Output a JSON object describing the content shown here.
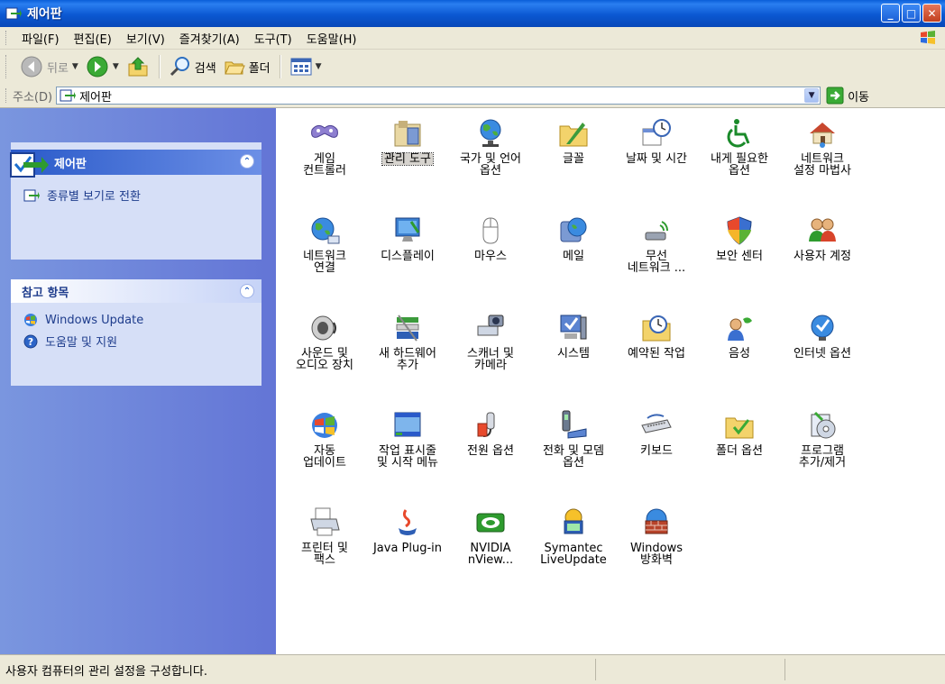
{
  "window": {
    "title": "제어판"
  },
  "menu": [
    {
      "label": "파일(F)"
    },
    {
      "label": "편집(E)"
    },
    {
      "label": "보기(V)"
    },
    {
      "label": "즐겨찾기(A)"
    },
    {
      "label": "도구(T)"
    },
    {
      "label": "도움말(H)"
    }
  ],
  "toolbar": {
    "back": "뒤로",
    "search": "검색",
    "folders": "폴더"
  },
  "address": {
    "label": "주소(D)",
    "value": "제어판",
    "go": "이동"
  },
  "sidebar": {
    "control_panel": {
      "title": "제어판",
      "switch_link": "종류별 보기로 전환"
    },
    "see_also": {
      "title": "참고 항목",
      "links": [
        "Windows Update",
        "도움말 및 지원"
      ]
    }
  },
  "icons": [
    {
      "label": "게임\n컨트롤러",
      "icon": "gamepad-icon"
    },
    {
      "label": "관리 도구",
      "icon": "admin-tools-icon"
    },
    {
      "label": "국가 및 언어\n옵션",
      "icon": "globe-icon"
    },
    {
      "label": "글꼴",
      "icon": "fonts-folder-icon"
    },
    {
      "label": "날짜 및 시간",
      "icon": "calendar-clock-icon"
    },
    {
      "label": "내게 필요한\n옵션",
      "icon": "accessibility-icon"
    },
    {
      "label": "네트워크\n설정 마법사",
      "icon": "network-house-icon"
    },
    {
      "label": "네트워크\n연결",
      "icon": "network-globe-icon"
    },
    {
      "label": "디스플레이",
      "icon": "display-icon"
    },
    {
      "label": "마우스",
      "icon": "mouse-icon"
    },
    {
      "label": "메일",
      "icon": "mail-icon"
    },
    {
      "label": "무선\n네트워크 ...",
      "icon": "wireless-icon"
    },
    {
      "label": "보안 센터",
      "icon": "shield-icon"
    },
    {
      "label": "사용자 계정",
      "icon": "users-icon"
    },
    {
      "label": "사운드 및\n오디오 장치",
      "icon": "speaker-icon"
    },
    {
      "label": "새 하드웨어\n추가",
      "icon": "hardware-icon"
    },
    {
      "label": "스캐너 및\n카메라",
      "icon": "scanner-camera-icon"
    },
    {
      "label": "시스템",
      "icon": "system-icon"
    },
    {
      "label": "예약된 작업",
      "icon": "scheduled-tasks-icon"
    },
    {
      "label": "음성",
      "icon": "speech-icon"
    },
    {
      "label": "인터넷 옵션",
      "icon": "internet-options-icon"
    },
    {
      "label": "자동\n업데이트",
      "icon": "windows-update-icon"
    },
    {
      "label": "작업 표시줄\n및 시작 메뉴",
      "icon": "taskbar-icon"
    },
    {
      "label": "전원 옵션",
      "icon": "power-icon"
    },
    {
      "label": "전화 및 모뎀\n옵션",
      "icon": "phone-modem-icon"
    },
    {
      "label": "키보드",
      "icon": "keyboard-icon"
    },
    {
      "label": "폴더 옵션",
      "icon": "folder-options-icon"
    },
    {
      "label": "프로그램\n추가/제거",
      "icon": "add-remove-programs-icon"
    },
    {
      "label": "프린터 및\n팩스",
      "icon": "printer-icon"
    },
    {
      "label": "Java Plug-in",
      "icon": "java-icon"
    },
    {
      "label": "NVIDIA\nnView...",
      "icon": "nvidia-icon"
    },
    {
      "label": "Symantec\nLiveUpdate",
      "icon": "symantec-icon"
    },
    {
      "label": "Windows\n방화벽",
      "icon": "firewall-icon"
    }
  ],
  "selected_icon": "관리 도구",
  "status": {
    "text": "사용자 컴퓨터의 관리 설정을 구성합니다."
  }
}
